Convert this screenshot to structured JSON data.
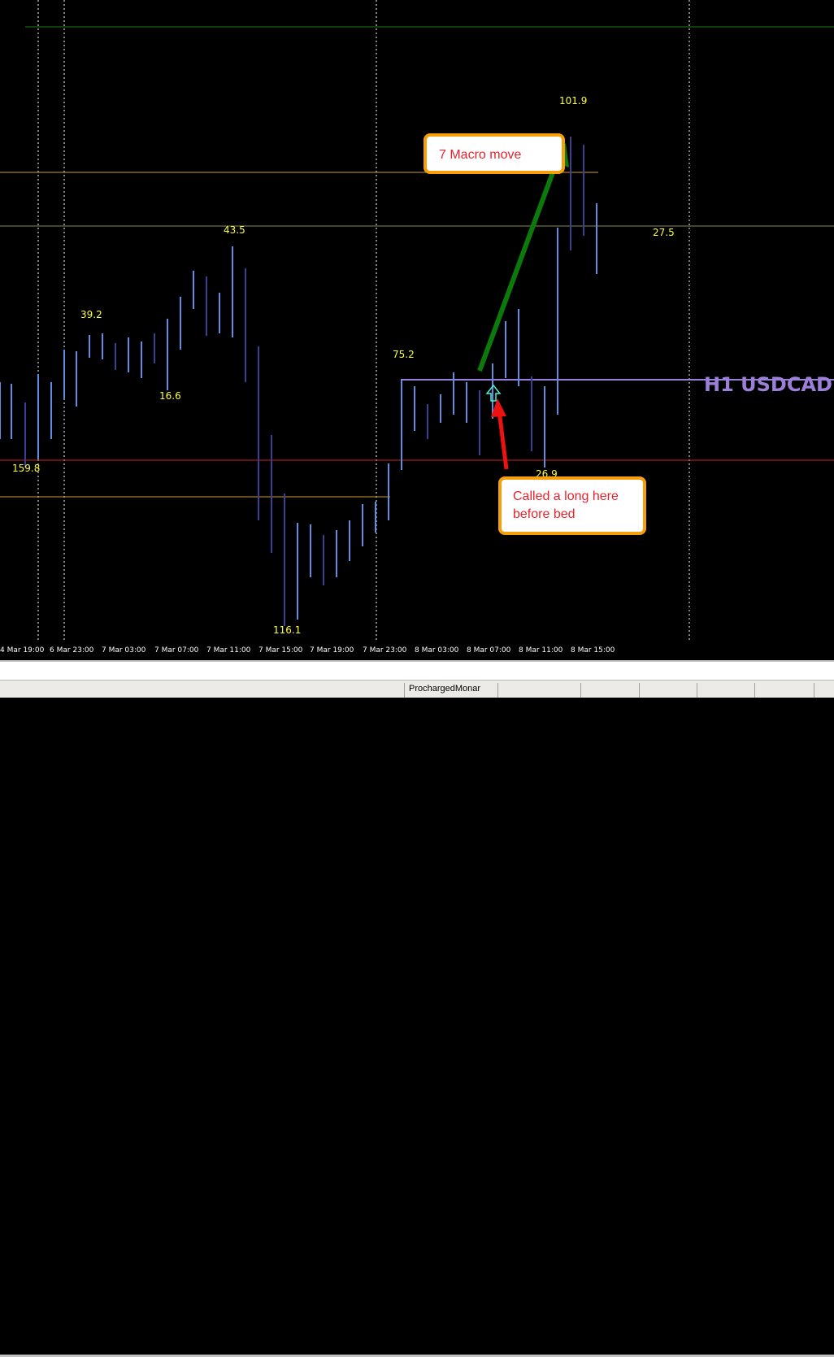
{
  "chart_data": {
    "type": "bar",
    "title": "H1 USDCAD",
    "x_tick_labels": [
      "4 Mar 19:00",
      "6 Mar 23:00",
      "7 Mar 03:00",
      "7 Mar 07:00",
      "7 Mar 11:00",
      "7 Mar 15:00",
      "7 Mar 19:00",
      "7 Mar 23:00",
      "8 Mar 03:00",
      "8 Mar 07:00",
      "8 Mar 11:00",
      "8 Mar 15:00"
    ],
    "annotations": [
      "159.8",
      "39.2",
      "16.6",
      "43.5",
      "116.1",
      "75.2",
      "26.9",
      "101.9",
      "27.5"
    ],
    "colors": {
      "background": "#000000",
      "bar_up": "#5b8ee6",
      "bar_down": "#3d3d99",
      "value_label": "#ffff33",
      "level_orange": "#c8a030",
      "level_red": "#d02020",
      "level_green": "#207a20",
      "level_olive": "#8a8a50",
      "level_purple": "#9b7fd8",
      "arrow_green": "#0b7a0b",
      "arrow_red": "#ee1111",
      "callout_border": "#f5a00a",
      "callout_text": "#e8232b"
    }
  },
  "callouts": {
    "macro_move": "7 Macro move",
    "long_entry": "Called a long here before bed"
  },
  "tab_bar": {
    "active_tab": "ProchargedMonar"
  }
}
